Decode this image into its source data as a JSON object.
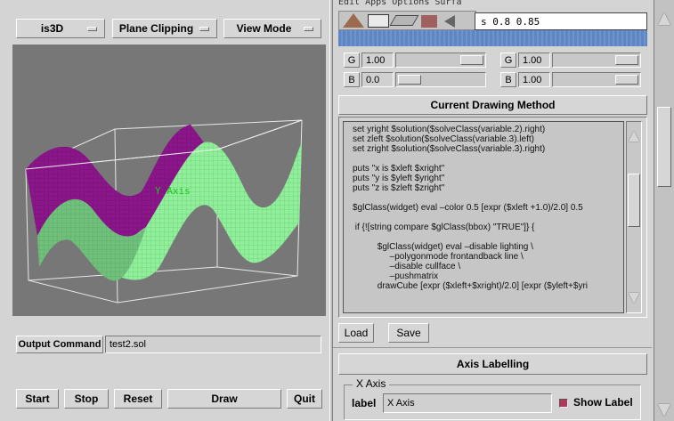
{
  "left_menu": {
    "is3d": "is3D",
    "plane_clipping": "Plane Clipping",
    "view_mode": "View Mode"
  },
  "viewer": {
    "axis_label": "Y Axis",
    "colors": {
      "background": "#777777",
      "surface_purple": "#8a168a",
      "surface_green": "#8ff09a",
      "axis_text": "#1ec41e"
    }
  },
  "output": {
    "label": "Output Command",
    "value": "test2.sol"
  },
  "bottom_buttons": {
    "start": "Start",
    "stop": "Stop",
    "reset": "Reset",
    "draw": "Draw",
    "quit": "Quit"
  },
  "top_right": {
    "cut_menu_text": "Edit Apps Options Surfa",
    "field_text": "s 0.8 0.85",
    "color_rows": [
      {
        "left_label": "G",
        "left_value": "1.00",
        "right_label": "G",
        "right_value": "1.00"
      },
      {
        "left_label": "B",
        "left_value": "0.0",
        "right_label": "B",
        "right_value": "1.00"
      }
    ]
  },
  "drawing": {
    "title": "Current Drawing Method",
    "code_lines": [
      "set yright $solution($solveClass(variable.2).right)",
      "set zleft $solution($solveClass(variable.3).left)",
      "set zright $solution($solveClass(variable.3).right)",
      "",
      "puts \"x is $xleft $xright\"",
      "puts \"y is $yleft $yright\"",
      "puts \"z is $zleft $zright\"",
      "",
      "$glClass(widget) eval –color 0.5 [expr ($xleft +1.0)/2.0] 0.5",
      "",
      " if {![string compare $glClass(bbox) \"TRUE\"]} {",
      "",
      "          $glClass(widget) eval –disable lighting \\",
      "               –polygonmode frontandback line \\",
      "               –disable cullface \\",
      "               –pushmatrix",
      "          drawCube [expr ($xleft+$xright)/2.0] [expr ($yleft+$yri"
    ],
    "load": "Load",
    "save": "Save"
  },
  "axis_labelling": {
    "title": "Axis Labelling",
    "group": "X Axis",
    "label": "label",
    "value": "X Axis",
    "show_label": "Show Label"
  }
}
